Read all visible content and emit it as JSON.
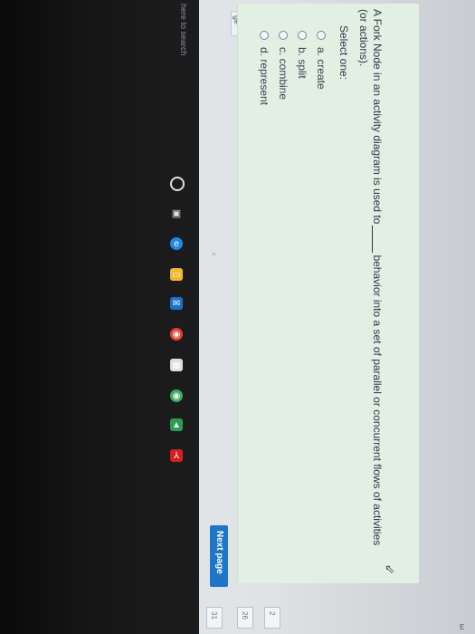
{
  "question": {
    "line1": "A Fork Node in an activity diagram is used to",
    "line1_end": "behavior into a set of parallel or concurrent flows of activities",
    "line2": "(or actions).",
    "select_one": "Select one:",
    "options": [
      {
        "label": "a. create"
      },
      {
        "label": "b. split"
      },
      {
        "label": "c. combine"
      },
      {
        "label": "d. represent"
      }
    ]
  },
  "navigation": {
    "next_page": "Next page"
  },
  "side_boxes": [
    "2",
    "26",
    "31"
  ],
  "left_label": "ge",
  "taskbar": {
    "search_placeholder": "here to search"
  },
  "corner_text": "E",
  "colors": {
    "panel": "#e2f0e4",
    "next_button": "#1f76c8",
    "taskbar": "#111111"
  },
  "icons": [
    "search-icon",
    "task-view-icon",
    "edge-icon",
    "file-explorer-icon",
    "mail-icon",
    "chrome-icon",
    "store-icon",
    "chrome-icon",
    "google-drive-icon",
    "acrobat-icon",
    "cursor-icon"
  ]
}
